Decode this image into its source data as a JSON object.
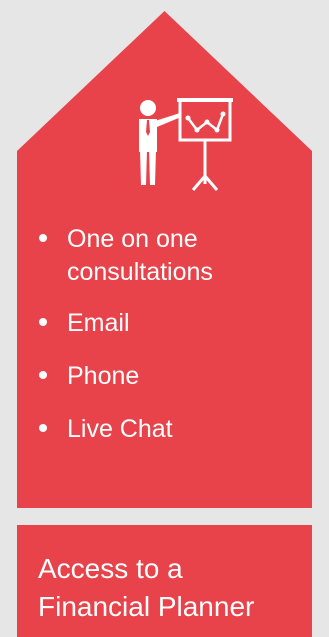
{
  "colors": {
    "accent": "#e8434b",
    "background": "#e6e6e6",
    "text": "#ffffff"
  },
  "icon": "presenter-with-chart-icon",
  "features": [
    "One on one consultations",
    "Email",
    "Phone",
    "Live Chat"
  ],
  "label": {
    "line1": "Access to a",
    "line2": "Financial Planner"
  }
}
